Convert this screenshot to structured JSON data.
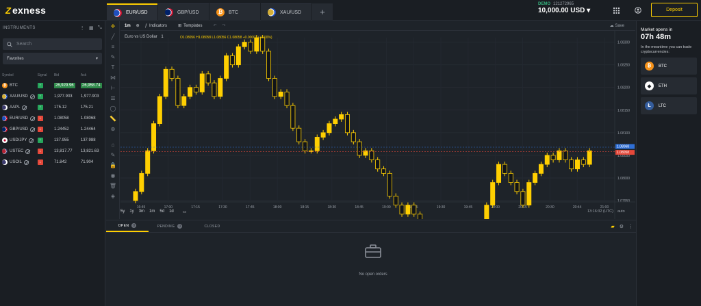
{
  "brand": {
    "name": "exness",
    "mark": "Z"
  },
  "tabs": [
    {
      "label": "EUR/USD",
      "flag": "eu",
      "active": true
    },
    {
      "label": "GBP/USD",
      "flag": "gb",
      "active": false
    },
    {
      "label": "BTC",
      "flag": "btc",
      "active": false
    },
    {
      "label": "XAU/USD",
      "flag": "xau",
      "active": false
    }
  ],
  "tab_add": "+",
  "account": {
    "mode": "DEMO",
    "number": "121272965",
    "balance": "10,000.00 USD"
  },
  "deposit_label": "Deposit",
  "sidebar": {
    "title": "INSTRUMENTS",
    "search_placeholder": "Search",
    "filter": "Favorites",
    "columns": [
      "Symbol",
      "Signal",
      "Bid",
      "Ask"
    ],
    "rows": [
      {
        "symbol": "BTC",
        "flag": "btc",
        "closed": false,
        "signal": "up",
        "bid": "26,929.96",
        "ask": "26,958.74",
        "highlight": true
      },
      {
        "symbol": "XAU/USD",
        "flag": "xau",
        "closed": true,
        "signal": "up",
        "bid": "1,977.903",
        "ask": "1,977.903",
        "highlight": false
      },
      {
        "symbol": "AAPL",
        "flag": "usd",
        "closed": true,
        "signal": "up",
        "bid": "175.12",
        "ask": "175.21",
        "highlight": false
      },
      {
        "symbol": "EUR/USD",
        "flag": "eu",
        "closed": true,
        "signal": "down",
        "bid": "1.08058",
        "ask": "1.08068",
        "highlight": false
      },
      {
        "symbol": "GBP/USD",
        "flag": "gb",
        "closed": true,
        "signal": "down",
        "bid": "1.24452",
        "ask": "1.24464",
        "highlight": false
      },
      {
        "symbol": "USD/JPY",
        "flag": "jp",
        "closed": true,
        "signal": "up",
        "bid": "137.955",
        "ask": "137.988",
        "highlight": false
      },
      {
        "symbol": "USTEC",
        "flag": "us",
        "closed": true,
        "signal": "down",
        "bid": "13,817.77",
        "ask": "13,821.63",
        "highlight": false
      },
      {
        "symbol": "USOIL",
        "flag": "usd",
        "closed": true,
        "signal": "down",
        "bid": "71.842",
        "ask": "71.904",
        "highlight": false
      }
    ]
  },
  "chart_toolbar": {
    "interval": "1m",
    "indicators": "Indicators",
    "templates": "Templates",
    "save": "Save"
  },
  "chart_data": {
    "type": "candlestick",
    "title": "Euro vs US Dollar",
    "interval": "1",
    "ohlc_text": "O1.08056 H1.08058 L1.08056 C1.08058 +0.00003 (+0.00%)",
    "x_ticks": [
      "16:45",
      "17:00",
      "17:15",
      "17:30",
      "17:45",
      "18:00",
      "18:15",
      "18:30",
      "18:45",
      "19:00",
      "19:15",
      "19:30",
      "19:45",
      "20:00",
      "20:15",
      "20:30",
      "20:44",
      "21:00"
    ],
    "y_ticks": [
      "1.08300",
      "1.08250",
      "1.08200",
      "1.08150",
      "1.08100",
      "1.08050",
      "1.08000",
      "1.07950"
    ],
    "ylim": [
      1.0795,
      1.0831
    ],
    "price_tags": [
      {
        "value": "1.08068",
        "color": "#2f6fd6"
      },
      {
        "value": "1.08058",
        "color": "#e5483a"
      }
    ],
    "closes": [
      1.0797,
      1.0801,
      1.0806,
      1.0812,
      1.0818,
      1.0824,
      1.0822,
      1.0816,
      1.0818,
      1.082,
      1.0819,
      1.0823,
      1.0821,
      1.0818,
      1.0822,
      1.0827,
      1.0825,
      1.0829,
      1.083,
      1.0828,
      1.0831,
      1.0828,
      1.0822,
      1.0818,
      1.0819,
      1.0816,
      1.0811,
      1.0808,
      1.0806,
      1.0806,
      1.0809,
      1.081,
      1.0812,
      1.0813,
      1.0814,
      1.081,
      1.0808,
      1.0805,
      1.0806,
      1.0804,
      1.0802,
      1.0801,
      1.0796,
      1.0794,
      1.0792,
      1.0794,
      1.0792,
      1.0789,
      1.0786,
      1.0783,
      1.0778,
      1.0777,
      1.0778,
      1.078,
      1.0782,
      1.0779,
      1.0784,
      1.0788,
      1.0794,
      1.0799,
      1.0803,
      1.0801,
      1.0799,
      1.0797,
      1.0794,
      1.0799,
      1.0801,
      1.0803,
      1.0805,
      1.0804,
      1.0806,
      1.0804,
      1.0802,
      1.0804,
      1.0803,
      1.0806
    ]
  },
  "timeframes": [
    "5y",
    "1y",
    "3m",
    "1m",
    "5d",
    "1d"
  ],
  "chart_clock": "13:16:32 (UTC)",
  "chart_auto": "auto",
  "orders": {
    "tabs": [
      {
        "label": "OPEN",
        "count": "0",
        "active": true
      },
      {
        "label": "PENDING",
        "count": "0",
        "active": false
      },
      {
        "label": "CLOSED",
        "count": "",
        "active": false
      }
    ],
    "empty_text": "No open orders"
  },
  "market": {
    "title": "Market opens in",
    "time": "07h 48m",
    "subtitle": "In the meantime you can trade cryptocurrencies:",
    "cryptos": [
      {
        "label": "BTC",
        "icon": "btc"
      },
      {
        "label": "ETH",
        "icon": "eth"
      },
      {
        "label": "LTC",
        "icon": "ltc"
      }
    ]
  }
}
